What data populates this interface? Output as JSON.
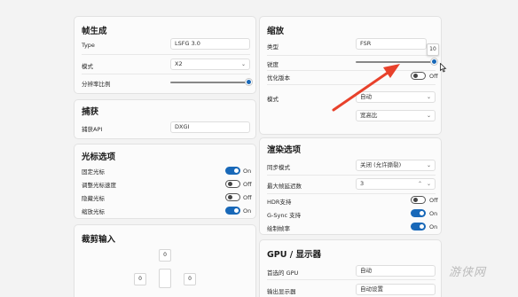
{
  "frame_gen": {
    "title": "帧生成",
    "type_label": "Type",
    "type_value": "LSFG 3.0",
    "mode_label": "模式",
    "mode_value": "X2",
    "flow_scale_label": "分辨率比例",
    "flow_scale_value": 1.0
  },
  "capture": {
    "title": "捕获",
    "api_label": "捕获API",
    "api_value": "DXGI"
  },
  "cursor": {
    "title": "光标选项",
    "items": [
      {
        "label": "固定光标",
        "state": "On"
      },
      {
        "label": "调整光标速度",
        "state": "Off"
      },
      {
        "label": "隐藏光标",
        "state": "Off"
      },
      {
        "label": "缩放光标",
        "state": "On"
      }
    ]
  },
  "crop": {
    "title": "裁剪输入",
    "values": [
      "0",
      "0",
      "0"
    ]
  },
  "scaling": {
    "title": "缩放",
    "type_label": "类型",
    "type_value": "FSR",
    "sharpness_label": "锐度",
    "sharpness_value": 10,
    "sharpness_max": 10,
    "sharpness_tooltip": "10",
    "optimize_label": "优化版本",
    "optimize_state": "Off",
    "mode_label": "模式",
    "mode_value": "自动",
    "aspect_value": "宽高比"
  },
  "render": {
    "title": "渲染选项",
    "sync_label": "同步模式",
    "sync_value": "关闭 (允许撕裂)",
    "max_frame_label": "最大帧延迟数",
    "max_frame_value": "3",
    "hdr_label": "HDR支持",
    "hdr_state": "Off",
    "gsync_label": "G-Sync 支持",
    "gsync_state": "On",
    "fps_label": "绘制帧率",
    "fps_state": "On"
  },
  "gpu": {
    "title": "GPU / 显示器",
    "preferred_label": "首选的 GPU",
    "preferred_value": "自动",
    "output_label": "输出显示器",
    "output_value": "自动设置"
  },
  "watermark": "游侠网",
  "colors": {
    "accent": "#1868b8",
    "arrow": "#e8412b"
  }
}
